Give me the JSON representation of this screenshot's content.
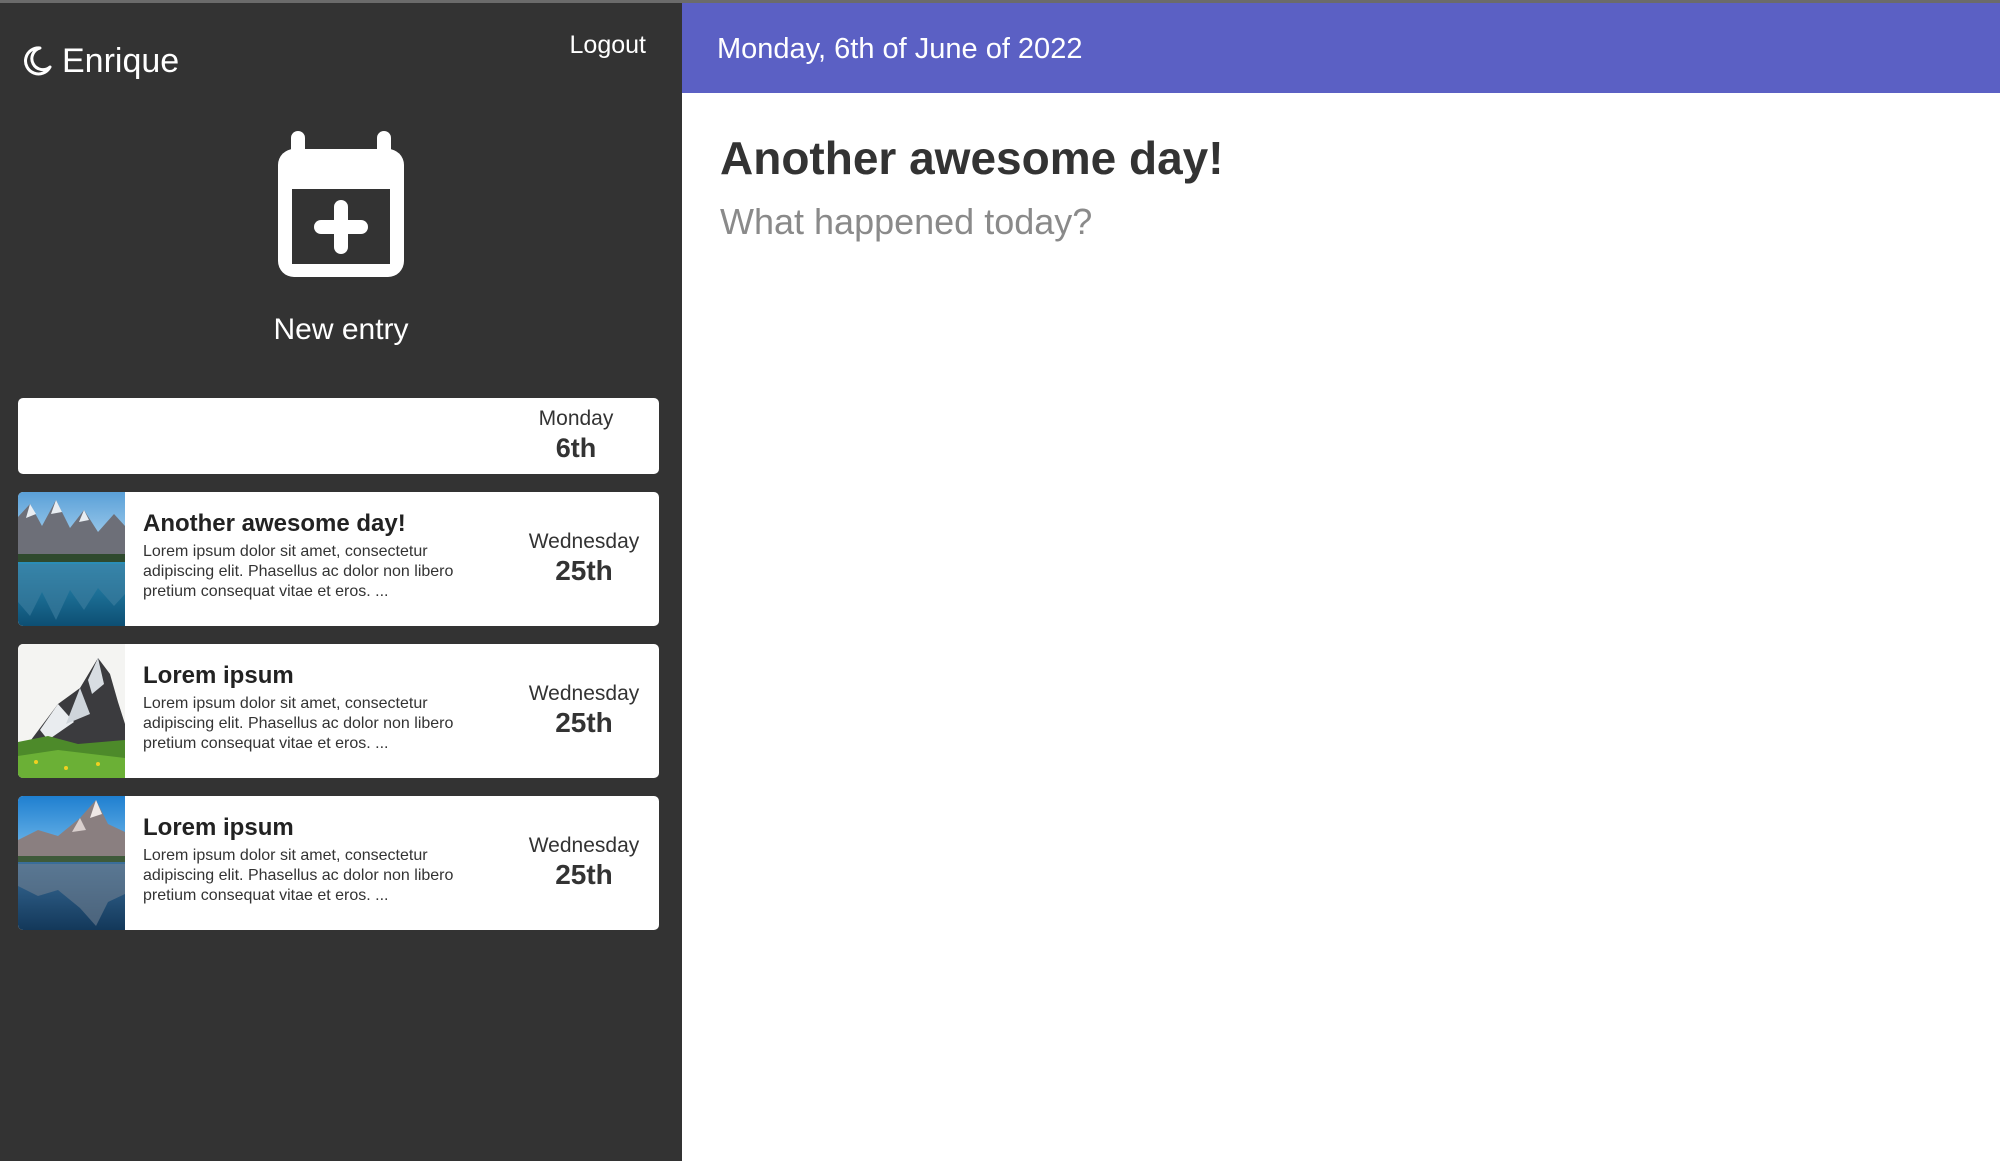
{
  "app": {
    "user_name": "Enrique",
    "logout_label": "Logout",
    "new_entry_label": "New entry",
    "accent_color": "#5b60c4",
    "sidebar_color": "#333333"
  },
  "entries": [
    {
      "title": "",
      "excerpt": "",
      "weekday": "Monday",
      "day": "6th",
      "image": "none"
    },
    {
      "title": "Another awesome day!",
      "excerpt": "Lorem ipsum dolor sit amet, consectetur adipiscing elit. Phasellus ac dolor non libero pretium consequat vitae et eros. ...",
      "weekday": "Wednesday",
      "day": "25th",
      "image": "mountain-lake"
    },
    {
      "title": "Lorem ipsum",
      "excerpt": "Lorem ipsum dolor sit amet, consectetur adipiscing elit. Phasellus ac dolor non libero pretium consequat vitae et eros. ...",
      "weekday": "Wednesday",
      "day": "25th",
      "image": "snowy-peak"
    },
    {
      "title": "Lorem ipsum",
      "excerpt": "Lorem ipsum dolor sit amet, consectetur adipiscing elit. Phasellus ac dolor non libero pretium consequat vitae et eros. ...",
      "weekday": "Wednesday",
      "day": "25th",
      "image": "mountain-reflection"
    }
  ],
  "editor": {
    "date_heading": "Monday, 6th of June of 2022",
    "title_value": "Another awesome day!",
    "body_placeholder": "What happened today?"
  }
}
